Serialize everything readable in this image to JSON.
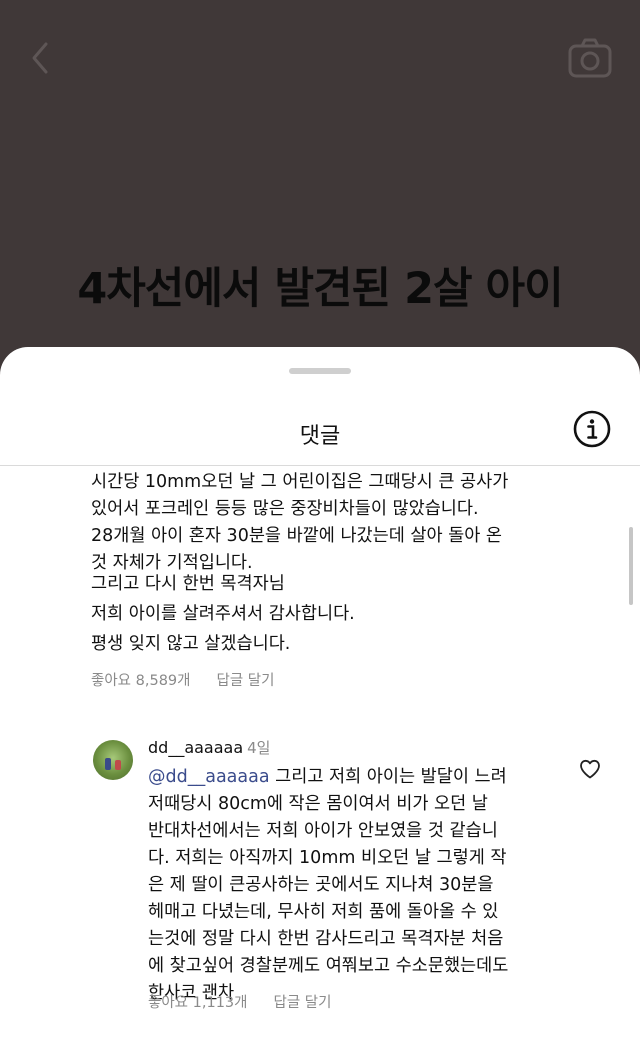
{
  "post": {
    "headline": "4차선에서 발견된 2살 아이"
  },
  "sheet": {
    "title": "댓글"
  },
  "comment1": {
    "lines": [
      "시간당 10mm오던 날 그 어린이집은 그때당시 큰 공사가",
      "있어서 포크레인 등등 많은 중장비차들이 많았습니다.",
      "28개월 아이 혼자 30분을 바깥에 나갔는데 살아 돌아 온",
      "것 자체가 기적입니다."
    ],
    "line2": "그리고 다시 한번 목격자님",
    "line3": "저희 아이를 살려주셔서 감사합니다.",
    "line4": "평생 잊지 않고 살겠습니다.",
    "likes": "좋아요 8,589개",
    "reply": "답글 달기"
  },
  "comment2": {
    "username": "dd__aaaaaa",
    "ago": "4일",
    "mention": "@dd__aaaaaa",
    "first_line_rest": " 그리고 저희 아이는 발달이 느려",
    "lines": [
      "저때당시 80cm에 작은 몸이여서 비가 오던 날",
      "반대차선에서는 저희 아이가 안보였을 것 같습니",
      "다. 저희는 아직까지 10mm 비오던 날 그렇게 작",
      "은 제 딸이 큰공사하는 곳에서도 지나쳐 30분을",
      "헤매고 다녔는데, 무사히 저희 품에 돌아올 수 있",
      "는것에 정말 다시 한번 감사드리고 목격자분 처음",
      "에 찾고싶어 경찰분께도 여쭤보고 수소문했는데도",
      "한사코 괜차"
    ],
    "likes": "좋아요 1,113개",
    "reply": "답글 달기"
  },
  "icons": {
    "back": "chevron-left-icon",
    "camera": "camera-icon",
    "info": "info-icon",
    "heart": "heart-icon"
  },
  "colors": {
    "overlay": "#403838",
    "mention": "#3b4c8c",
    "meta": "#8a8a8a"
  }
}
